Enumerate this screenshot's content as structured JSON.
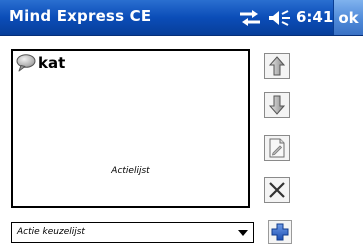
{
  "window": {
    "title": "Mind Express CE",
    "time": "6:41",
    "ok_label": "ok",
    "status_icons": [
      "connectivity-icon",
      "speaker-icon"
    ]
  },
  "action_list": {
    "items": [
      {
        "icon": "speech-bubble-icon",
        "label": "kat"
      }
    ],
    "caption": "Actielijst"
  },
  "side_buttons": [
    {
      "icon": "up-arrow-icon"
    },
    {
      "icon": "down-arrow-icon"
    },
    {
      "icon": "edit-document-icon"
    },
    {
      "icon": "delete-x-icon"
    }
  ],
  "action_combo": {
    "value": "Actie keuzelijst"
  },
  "add_button": {
    "icon": "plus-icon"
  },
  "colors": {
    "titlebar": "#0b4db8",
    "ok_button": "#4f8ad9",
    "add_plus": "#2f63c7"
  }
}
